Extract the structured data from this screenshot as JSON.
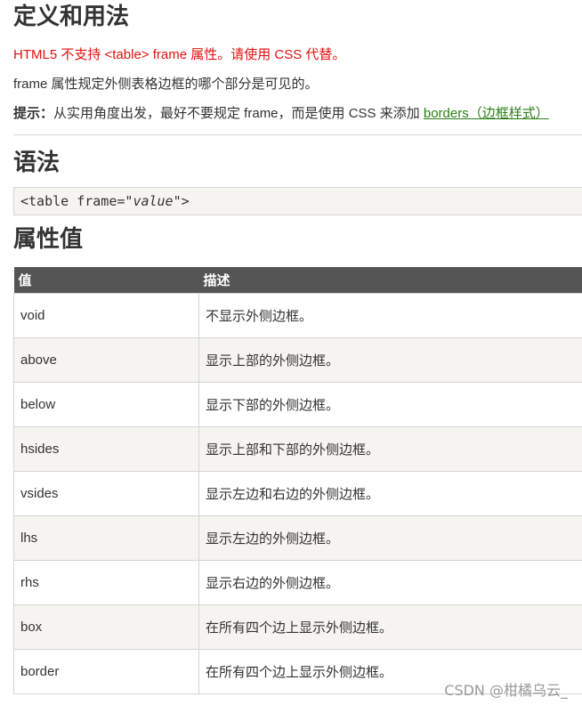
{
  "definition": {
    "title": "定义和用法",
    "deprecated_note": "HTML5 不支持 <table> frame 属性。请使用 CSS 代替。",
    "description": "frame 属性规定外侧表格边框的哪个部分是可见的。",
    "tip_label": "提示：",
    "tip_text": "从实用角度出发，最好不要规定 frame，而是使用 CSS 来添加 ",
    "tip_link": "borders（边框样式）"
  },
  "syntax": {
    "title": "语法",
    "code_prefix": "<table frame=\"",
    "code_value": "value",
    "code_suffix": "\">"
  },
  "values": {
    "title": "属性值",
    "headers": [
      "值",
      "描述"
    ],
    "rows": [
      {
        "value": "void",
        "desc": "不显示外侧边框。"
      },
      {
        "value": "above",
        "desc": "显示上部的外侧边框。"
      },
      {
        "value": "below",
        "desc": "显示下部的外侧边框。"
      },
      {
        "value": "hsides",
        "desc": "显示上部和下部的外侧边框。"
      },
      {
        "value": "vsides",
        "desc": "显示左边和右边的外侧边框。"
      },
      {
        "value": "lhs",
        "desc": "显示左边的外侧边框。"
      },
      {
        "value": "rhs",
        "desc": "显示右边的外侧边框。"
      },
      {
        "value": "box",
        "desc": "在所有四个边上显示外侧边框。"
      },
      {
        "value": "border",
        "desc": "在所有四个边上显示外侧边框。"
      }
    ]
  },
  "watermark": "CSDN @柑橘乌云_"
}
